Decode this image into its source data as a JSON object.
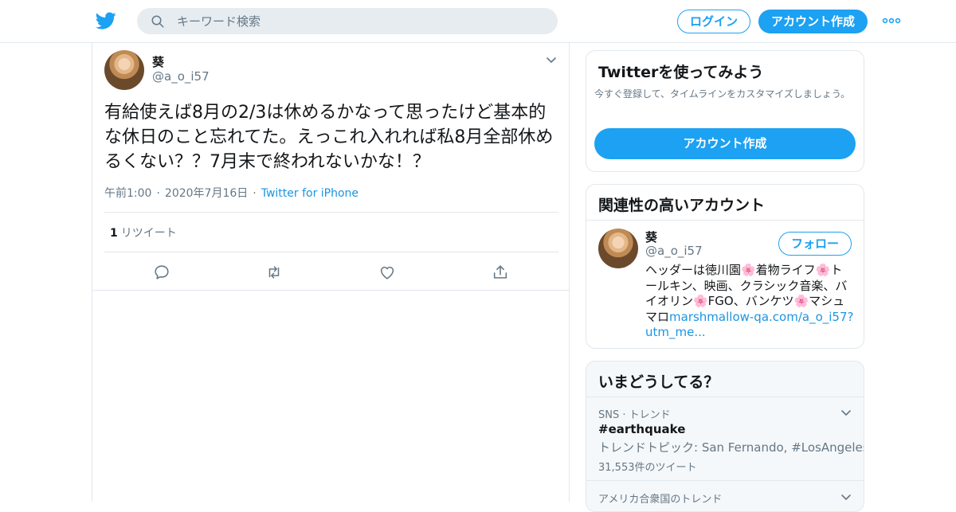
{
  "header": {
    "search_placeholder": "キーワード検索",
    "login_label": "ログイン",
    "signup_label": "アカウント作成"
  },
  "tweet": {
    "author_name": "葵",
    "author_handle": "@a_o_i57",
    "text": "有給使えば8月の2/3は休めるかなって思ったけど基本的な休日のこと忘れてた。えっこれ入れれば私8月全部休めるくない？？7月末で終われないかな！？",
    "time": "午前1:00",
    "date": "2020年7月16日",
    "source": "Twitter for iPhone",
    "retweet_count": "1",
    "retweet_label": "リツイート"
  },
  "try_card": {
    "title": "Twitterを使ってみよう",
    "subtitle": "今すぐ登録して、タイムラインをカスタマイズしましょう。",
    "button_label": "アカウント作成"
  },
  "related_card": {
    "title": "関連性の高いアカウント",
    "name": "葵",
    "handle": "@a_o_i57",
    "follow_label": "フォロー",
    "bio_text": "ヘッダーは徳川園🌸着物ライフ🌸トールキン、映画、クラシック音楽、バイオリン🌸FGO、バンケツ🌸マシュマロ",
    "bio_link": "marshmallow-qa.com/a_o_i57?utm_me..."
  },
  "trends_card": {
    "title": "いまどうしてる？",
    "trends": [
      {
        "category": "SNS · トレンド",
        "title": "#earthquake",
        "description": "トレンドトピック: San Fernando, #LosAngeles",
        "count": "31,553件のツイート"
      },
      {
        "category": "アメリカ合衆国のトレンド"
      }
    ]
  },
  "colors": {
    "accent": "#1da1f2",
    "link": "#1b95e0",
    "secondary_text": "#657786",
    "border": "#e1e8ed"
  }
}
